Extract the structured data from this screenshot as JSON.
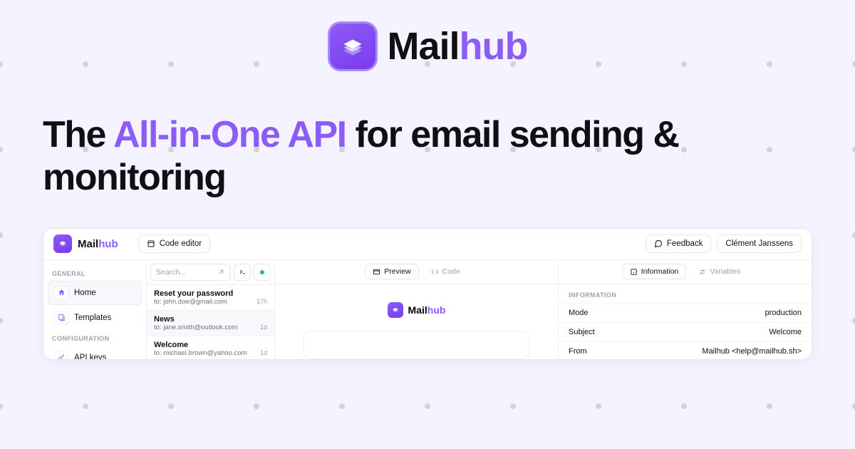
{
  "brand": {
    "part1": "Mail",
    "part2": "hub"
  },
  "headline": {
    "pre": "The ",
    "accent": "All-in-One API",
    "post": " for email sending & monitoring"
  },
  "app": {
    "header": {
      "code_editor_label": "Code editor",
      "feedback_label": "Feedback",
      "user_name": "Clément Janssens"
    },
    "sidebar": {
      "sections": [
        {
          "label": "GENERAL",
          "items": [
            {
              "label": "Home",
              "icon": "home",
              "active": true
            },
            {
              "label": "Templates",
              "icon": "templates",
              "active": false
            }
          ]
        },
        {
          "label": "CONFIGURATION",
          "items": [
            {
              "label": "API keys",
              "icon": "key",
              "active": false
            }
          ]
        }
      ]
    },
    "list": {
      "search_placeholder": "Search...",
      "items": [
        {
          "title": "Reset your password",
          "to": "to: john.doe@gmail.com",
          "time": "17h",
          "active": false
        },
        {
          "title": "News",
          "to": "to: jane.smith@outlook.com",
          "time": "1d",
          "active": true
        },
        {
          "title": "Welcome",
          "to": "to: michael.brown@yahoo.com",
          "time": "1d",
          "active": false
        }
      ]
    },
    "preview": {
      "tabs": [
        {
          "label": "Preview",
          "active": true
        },
        {
          "label": "Code",
          "active": false
        }
      ]
    },
    "info": {
      "tabs": [
        {
          "label": "Information",
          "active": true
        },
        {
          "label": "Variables",
          "active": false
        }
      ],
      "section_label": "INFORMATION",
      "rows": [
        {
          "key": "Mode",
          "value": "production"
        },
        {
          "key": "Subject",
          "value": "Welcome"
        },
        {
          "key": "From",
          "value": "Mailhub <help@mailhub.sh>"
        }
      ]
    }
  }
}
